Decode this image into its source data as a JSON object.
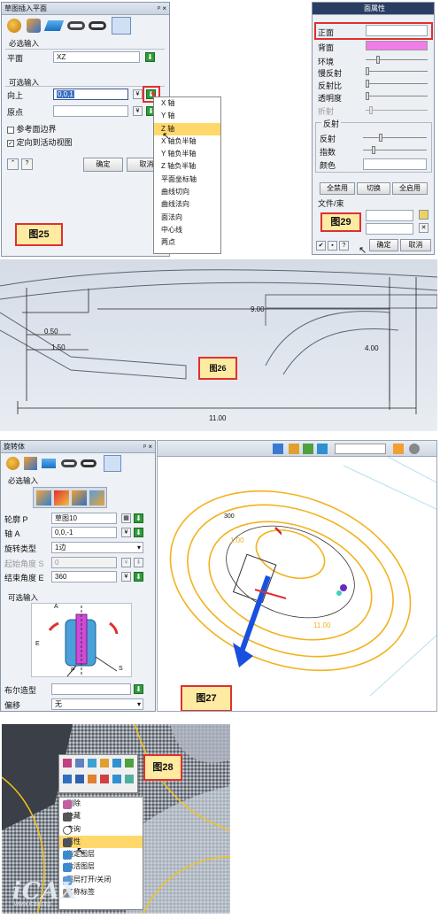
{
  "fig25": {
    "title": "草图插入平面",
    "title_btns": "ᵖ ×",
    "required_label": "必选输入",
    "plane_label": "平面",
    "plane_value": "XZ",
    "optional_label": "可选输入",
    "up_label": "向上",
    "up_value": "0,0,1",
    "origin_label": "原点",
    "ref_boundary": "参考面边界",
    "orient_view": "定向到活动视图",
    "ok": "确定",
    "cancel": "取消",
    "caption": "图25",
    "menu": [
      "X 轴",
      "Y 轴",
      "Z 轴",
      "X 轴负半轴",
      "Y 轴负半轴",
      "Z 轴负半轴",
      "平面坐标轴",
      "曲线切向",
      "曲线法向",
      "面法向",
      "中心线",
      "两点"
    ],
    "menu_selected": "Z 轴"
  },
  "fig29": {
    "title": "面属性",
    "front_label": "正面",
    "back_label": "背面",
    "back_color": "#f07de8",
    "sliders": [
      "环境",
      "慢反射",
      "反射比",
      "透明度",
      "折射"
    ],
    "reflect_section": "反射",
    "reflect_label": "反射",
    "index_label": "指数",
    "color_label": "颜色",
    "btn_disable_all": "全禁用",
    "btn_switch": "切换",
    "btn_enable_all": "全启用",
    "file_label": "文件/束",
    "caption": "图29",
    "ok": "确定",
    "cancel": "取消"
  },
  "fig26": {
    "caption": "图26",
    "dims": [
      "9.00",
      "0.50",
      "1.50",
      "4.00",
      "11.00"
    ]
  },
  "fig27": {
    "title": "旋转体",
    "title_btns": "ᵖ ×",
    "required_label": "必选输入",
    "profile_label": "轮廓 P",
    "profile_value": "草图10",
    "axis_label": "轴 A",
    "axis_value": "0,0,-1",
    "rot_type_label": "旋转类型",
    "rot_type_value": "1边",
    "start_angle_label": "起始角度 S",
    "start_angle_value": "0",
    "end_angle_label": "结束角度 E",
    "end_angle_value": "360",
    "optional_label": "可选输入",
    "bool_label": "布尔造型",
    "offset_label": "偏移",
    "offset_value": "无",
    "caption": "图27",
    "dims": [
      "300",
      "1.00",
      "11.00"
    ],
    "diagram_labels": [
      "A",
      "E",
      "P",
      "S"
    ]
  },
  "fig28": {
    "caption": "图28",
    "menu": [
      "删除",
      "隐藏",
      "查询",
      "属性",
      "指定图层",
      "激活图层",
      "图层打开/关闭",
      "名称标签"
    ],
    "menu_selected": "属性",
    "watermark": "www.icax.org",
    "logo": "iCAX"
  }
}
